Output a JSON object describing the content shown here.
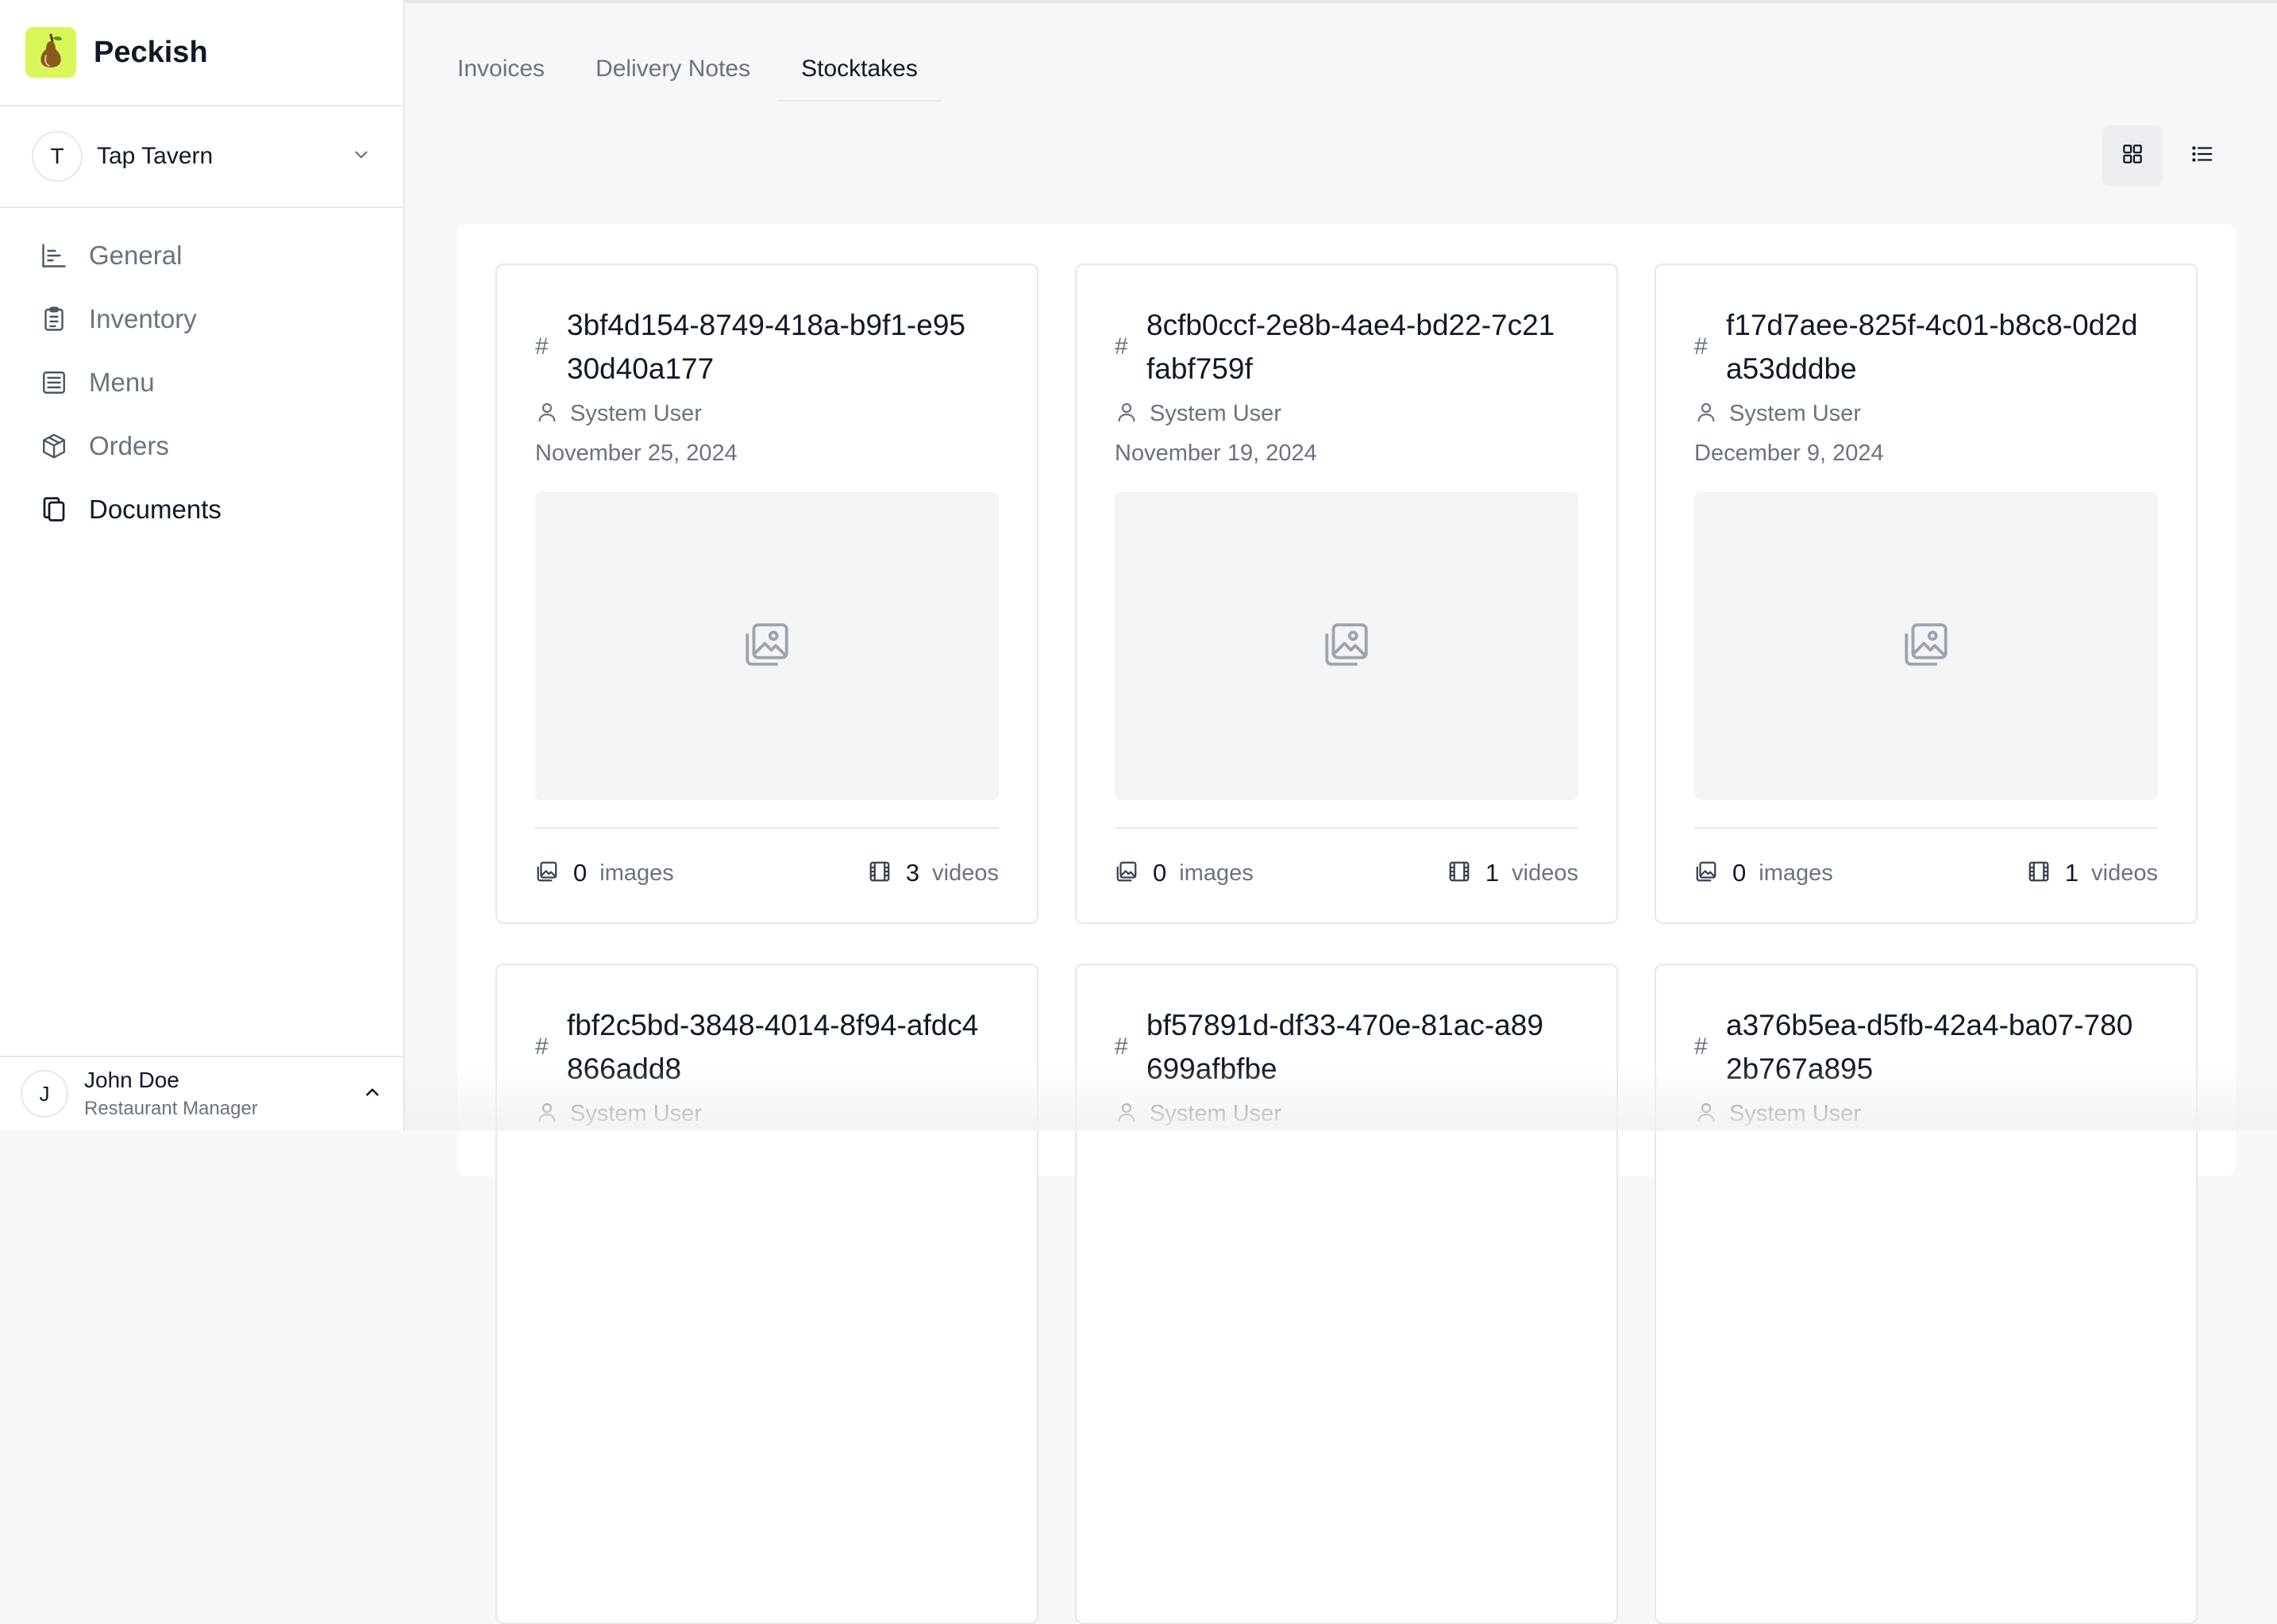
{
  "app": {
    "name": "Peckish"
  },
  "org": {
    "initial": "T",
    "name": "Tap Tavern"
  },
  "nav": [
    {
      "label": "General",
      "icon": "chart-icon",
      "active": false
    },
    {
      "label": "Inventory",
      "icon": "clipboard-icon",
      "active": false
    },
    {
      "label": "Menu",
      "icon": "list-icon",
      "active": false
    },
    {
      "label": "Orders",
      "icon": "box-icon",
      "active": false
    },
    {
      "label": "Documents",
      "icon": "copy-icon",
      "active": true
    }
  ],
  "user": {
    "initial": "J",
    "name": "John Doe",
    "role": "Restaurant Manager"
  },
  "tabs": [
    {
      "label": "Invoices",
      "active": false
    },
    {
      "label": "Delivery Notes",
      "active": false
    },
    {
      "label": "Stocktakes",
      "active": true
    }
  ],
  "view": {
    "selected": "grid"
  },
  "cards": [
    {
      "id": "3bf4d154-8749-418a-b9f1-e9530d40a177",
      "user": "System User",
      "date": "November 25, 2024",
      "images_count": "0",
      "images_label": "images",
      "videos_count": "3",
      "videos_label": "videos"
    },
    {
      "id": "8cfb0ccf-2e8b-4ae4-bd22-7c21fabf759f",
      "user": "System User",
      "date": "November 19, 2024",
      "images_count": "0",
      "images_label": "images",
      "videos_count": "1",
      "videos_label": "videos"
    },
    {
      "id": "f17d7aee-825f-4c01-b8c8-0d2da53dddbe",
      "user": "System User",
      "date": "December 9, 2024",
      "images_count": "0",
      "images_label": "images",
      "videos_count": "1",
      "videos_label": "videos"
    },
    {
      "id": "fbf2c5bd-3848-4014-8f94-afdc4866add8",
      "user": "System User"
    },
    {
      "id": "bf57891d-df33-470e-81ac-a89699afbfbe",
      "user": "System User"
    },
    {
      "id": "a376b5ea-d5fb-42a4-ba07-7802b767a895",
      "user": "System User"
    }
  ],
  "colors": {
    "brand": "#d9f75a",
    "text": "#111827",
    "muted": "#6b7280",
    "border": "#e5e7eb"
  }
}
